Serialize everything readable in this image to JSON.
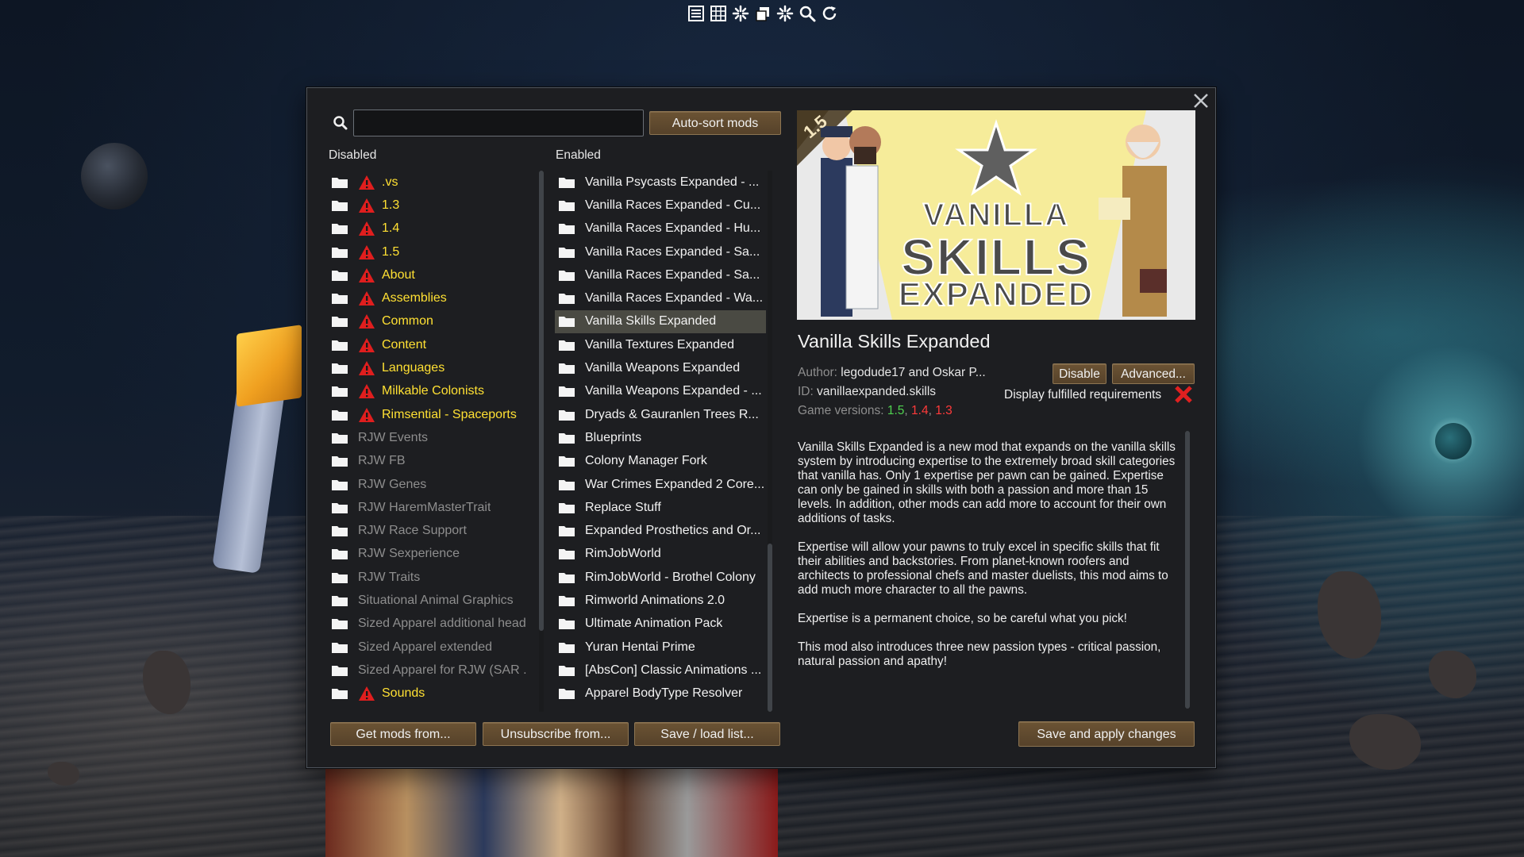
{
  "toolbar": {
    "icons": [
      "list-icon",
      "grid-icon",
      "spark-icon",
      "copy-icon",
      "spark-alt-icon",
      "search-icon",
      "refresh-icon"
    ]
  },
  "search": {
    "value": "",
    "placeholder": ""
  },
  "buttons": {
    "auto_sort": "Auto-sort mods",
    "get_mods": "Get mods from...",
    "unsubscribe": "Unsubscribe from...",
    "save_load": "Save / load list...",
    "disable": "Disable",
    "advanced": "Advanced...",
    "save_apply": "Save and apply changes"
  },
  "disabled": {
    "header": "Disabled",
    "items": [
      {
        "label": ".vs",
        "warning": true
      },
      {
        "label": "1.3",
        "warning": true
      },
      {
        "label": "1.4",
        "warning": true
      },
      {
        "label": "1.5",
        "warning": true
      },
      {
        "label": "About",
        "warning": true
      },
      {
        "label": "Assemblies",
        "warning": true
      },
      {
        "label": "Common",
        "warning": true
      },
      {
        "label": "Content",
        "warning": true
      },
      {
        "label": "Languages",
        "warning": true
      },
      {
        "label": "Milkable Colonists",
        "warning": true
      },
      {
        "label": "Rimsential - Spaceports",
        "warning": true
      },
      {
        "label": "RJW Events",
        "warning": false
      },
      {
        "label": "RJW FB",
        "warning": false
      },
      {
        "label": "RJW Genes",
        "warning": false
      },
      {
        "label": "RJW HaremMasterTrait",
        "warning": false
      },
      {
        "label": "RJW Race Support",
        "warning": false
      },
      {
        "label": "RJW Sexperience",
        "warning": false
      },
      {
        "label": "RJW Traits",
        "warning": false
      },
      {
        "label": "Situational Animal Graphics",
        "warning": false
      },
      {
        "label": "Sized Apparel additional heads",
        "warning": false
      },
      {
        "label": "Sized Apparel extended",
        "warning": false
      },
      {
        "label": "Sized Apparel for RJW (SAR ...",
        "warning": false
      },
      {
        "label": "Sounds",
        "warning": true
      }
    ]
  },
  "enabled": {
    "header": "Enabled",
    "items": [
      {
        "label": "Vanilla Psycasts Expanded - ...",
        "selected": false
      },
      {
        "label": "Vanilla Races Expanded - Cu...",
        "selected": false
      },
      {
        "label": "Vanilla Races Expanded - Hu...",
        "selected": false
      },
      {
        "label": "Vanilla Races Expanded - Sa...",
        "selected": false
      },
      {
        "label": "Vanilla Races Expanded - Sa...",
        "selected": false
      },
      {
        "label": "Vanilla Races Expanded - Wa...",
        "selected": false
      },
      {
        "label": "Vanilla Skills Expanded",
        "selected": true
      },
      {
        "label": "Vanilla Textures Expanded",
        "selected": false
      },
      {
        "label": "Vanilla Weapons Expanded",
        "selected": false
      },
      {
        "label": "Vanilla Weapons Expanded - ...",
        "selected": false
      },
      {
        "label": "Dryads & Gauranlen Trees R...",
        "selected": false
      },
      {
        "label": "Blueprints",
        "selected": false
      },
      {
        "label": "Colony Manager Fork",
        "selected": false
      },
      {
        "label": "War Crimes Expanded 2 Core...",
        "selected": false
      },
      {
        "label": "Replace Stuff",
        "selected": false
      },
      {
        "label": "Expanded Prosthetics and Or...",
        "selected": false
      },
      {
        "label": "RimJobWorld",
        "selected": false
      },
      {
        "label": "RimJobWorld - Brothel Colony",
        "selected": false
      },
      {
        "label": "Rimworld Animations 2.0",
        "selected": false
      },
      {
        "label": "Ultimate Animation Pack",
        "selected": false
      },
      {
        "label": "Yuran Hentai Prime",
        "selected": false
      },
      {
        "label": "[AbsCon] Classic Animations ...",
        "selected": false
      },
      {
        "label": "Apparel BodyType Resolver",
        "selected": false
      }
    ]
  },
  "mod": {
    "version_badge": "1.5",
    "banner_line1": "VANILLA",
    "banner_line2": "SKILLS",
    "banner_line3": "EXPANDED",
    "title": "Vanilla Skills Expanded",
    "author_label": "Author:",
    "author": "legodude17 and Oskar P...",
    "id_label": "ID:",
    "id": "vanillaexpanded.skills",
    "versions_label": "Game versions:",
    "versions": [
      {
        "v": "1.5",
        "color": "#4fd14f"
      },
      {
        "v": "1.4",
        "color": "#ff3a3a"
      },
      {
        "v": "1.3",
        "color": "#ff3a3a"
      }
    ],
    "requirements_label": "Display fulfilled requirements",
    "description": [
      "Vanilla Skills Expanded is a new mod that expands on the vanilla skills system by introducing expertise to the extremely broad skill categories that vanilla has. Only 1 expertise per pawn can be gained. Expertise can only be gained in skills with both a passion and more than 15 levels. In addition, other mods can add more to account for their own additions of tasks.",
      "Expertise will allow your pawns to truly excel in specific skills that fit their abilities and backstories. From planet-known roofers and architects to professional chefs and master duelists, this mod aims to add much more character to all the pawns.",
      "Expertise is a permanent choice, so be careful what you pick!",
      "This mod also introduces three new passion types - critical passion, natural passion and apathy!"
    ]
  },
  "colors": {
    "warning_text": "#ffe033",
    "version_ok": "#4fd14f",
    "version_bad": "#ff3a3a",
    "button_bg": "#5f4a2f"
  }
}
